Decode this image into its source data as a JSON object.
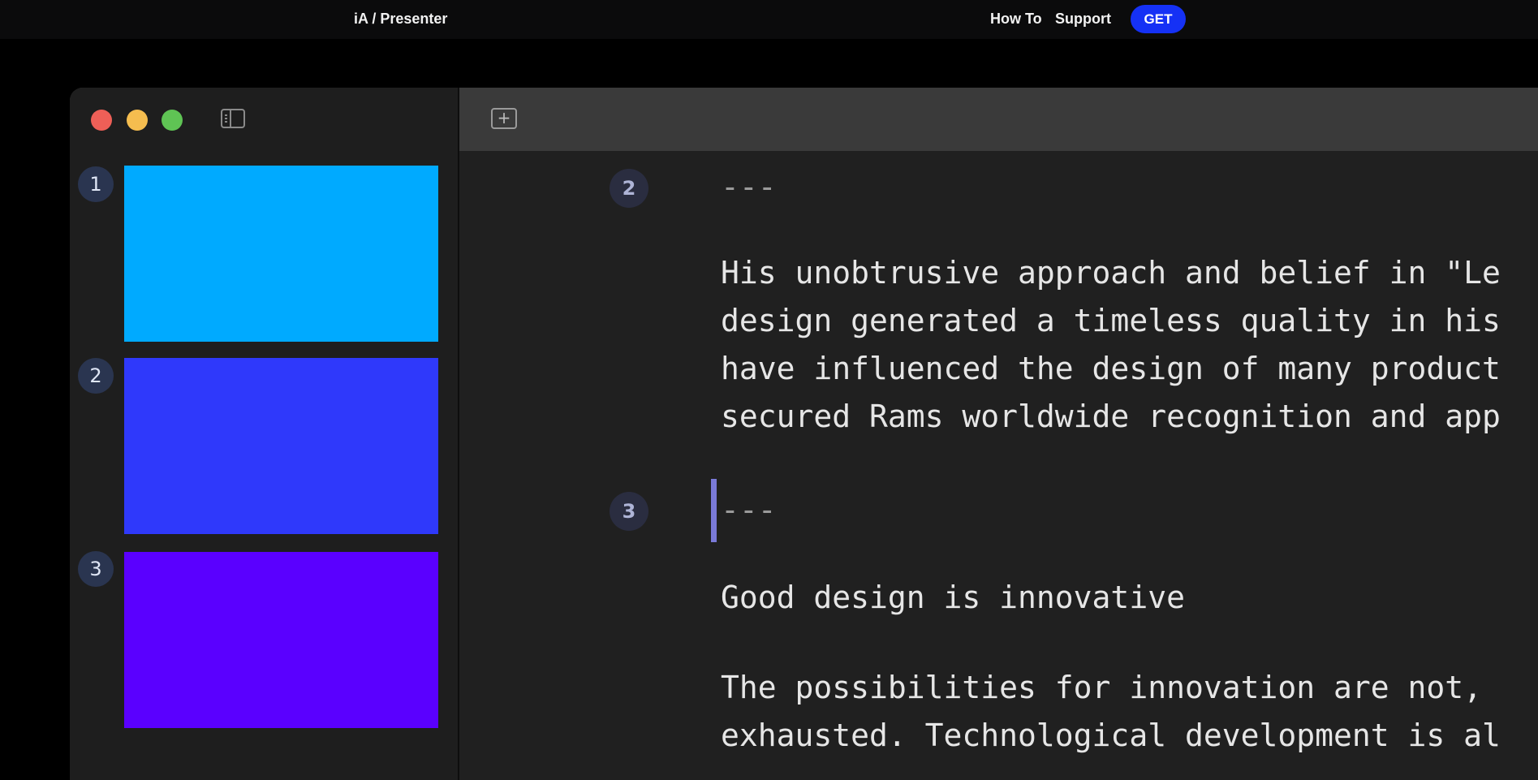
{
  "nav": {
    "brand": "iA / Presenter",
    "how_to": "How To",
    "support": "Support",
    "get": "GET"
  },
  "sidebar": {
    "slides": [
      {
        "number": "1",
        "color": "#00aaff"
      },
      {
        "number": "2",
        "color": "#2f39fb"
      },
      {
        "number": "3",
        "color": "#5a00ff"
      }
    ]
  },
  "editor": {
    "slide2_number": "2",
    "slide2_separator": "---",
    "slide2_lines": [
      "His unobtrusive approach and belief in \"Le",
      "design generated a timeless quality in his",
      "have influenced the design of many product",
      "secured Rams worldwide recognition and app"
    ],
    "slide3_number": "3",
    "slide3_separator": "---",
    "slide3_heading": "Good design is innovative",
    "slide3_lines": [
      "The possibilities for innovation are not,",
      "exhausted. Technological development is al"
    ]
  }
}
